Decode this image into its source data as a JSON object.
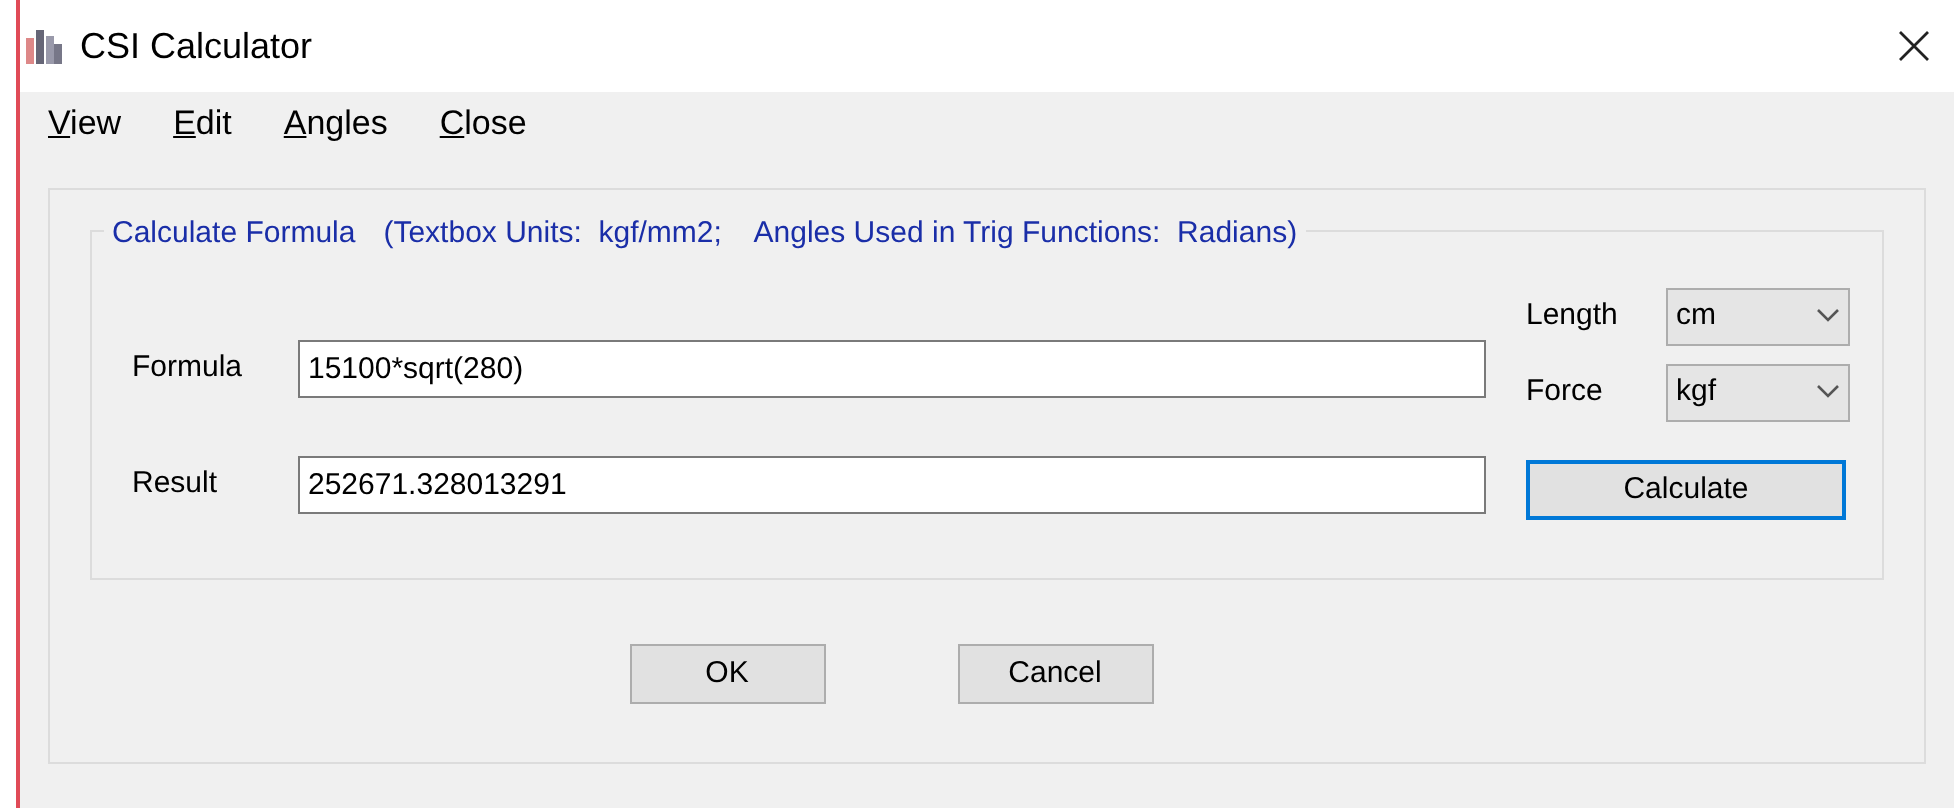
{
  "window": {
    "title": "CSI Calculator"
  },
  "menu": [
    {
      "label": "View",
      "underline_first": true
    },
    {
      "label": "Edit",
      "underline_first": true
    },
    {
      "label": "Angles",
      "underline_first": true
    },
    {
      "label": "Close",
      "underline_first": true
    }
  ],
  "group": {
    "title": "Calculate Formula",
    "note": "(Textbox Units:  kgf/mm2;    Angles Used in Trig Functions:  Radians)"
  },
  "formula": {
    "label": "Formula",
    "value": "15100*sqrt(280)"
  },
  "result": {
    "label": "Result",
    "value": "252671.328013291"
  },
  "units": [
    {
      "label": "Length",
      "value": "cm"
    },
    {
      "label": "Force",
      "value": "kgf"
    }
  ],
  "calculate_button": {
    "label": "Calculate",
    "focused": true
  },
  "buttons": [
    {
      "label": "OK"
    },
    {
      "label": "Cancel"
    }
  ]
}
